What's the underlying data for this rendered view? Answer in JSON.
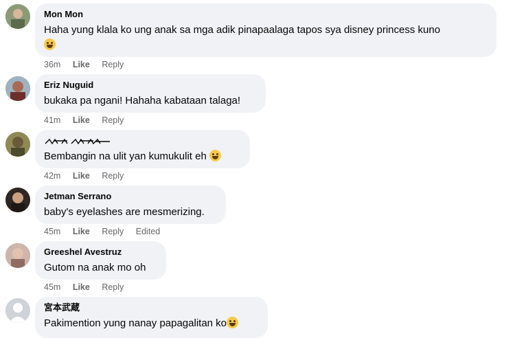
{
  "comments": [
    {
      "name": "Mon Mon",
      "text": "Haha yung klala ko ung anak sa mga adik pinapaalaga tapos sya disney princess kuno",
      "time": "36m",
      "like": "Like",
      "reply": "Reply",
      "edited": "",
      "avatar_color": "#7a8a6a"
    },
    {
      "name": "Eriz Nuguid",
      "text": "bukaka pa ngani! Hahaha kabataan talaga!",
      "time": "41m",
      "like": "Like",
      "reply": "Reply",
      "edited": "",
      "avatar_color": "#6b7d8c"
    },
    {
      "name": "",
      "text": "Bembangin na ulit yan kumukulit eh",
      "time": "42m",
      "like": "Like",
      "reply": "Reply",
      "edited": "",
      "avatar_color": "#8d8a55"
    },
    {
      "name": "Jetman Serrano",
      "text": "baby's eyelashes are mesmerizing.",
      "time": "45m",
      "like": "Like",
      "reply": "Reply",
      "edited": "Edited",
      "avatar_color": "#3a2e28"
    },
    {
      "name": "Greeshel Avestruz",
      "text": "Gutom na anak mo oh",
      "time": "45m",
      "like": "Like",
      "reply": "Reply",
      "edited": "",
      "avatar_color": "#b08f84"
    },
    {
      "name": "宮本武蔵",
      "text": "Pakimention yung nanay papagalitan ko",
      "time": "",
      "like": "",
      "reply": "",
      "edited": "",
      "avatar_color": "#cfd3d8"
    }
  ],
  "icons": {
    "emoji": "grinning-face-emoji",
    "laugh": "laughing-face-emoji",
    "default_avatar": "default-avatar-icon"
  }
}
